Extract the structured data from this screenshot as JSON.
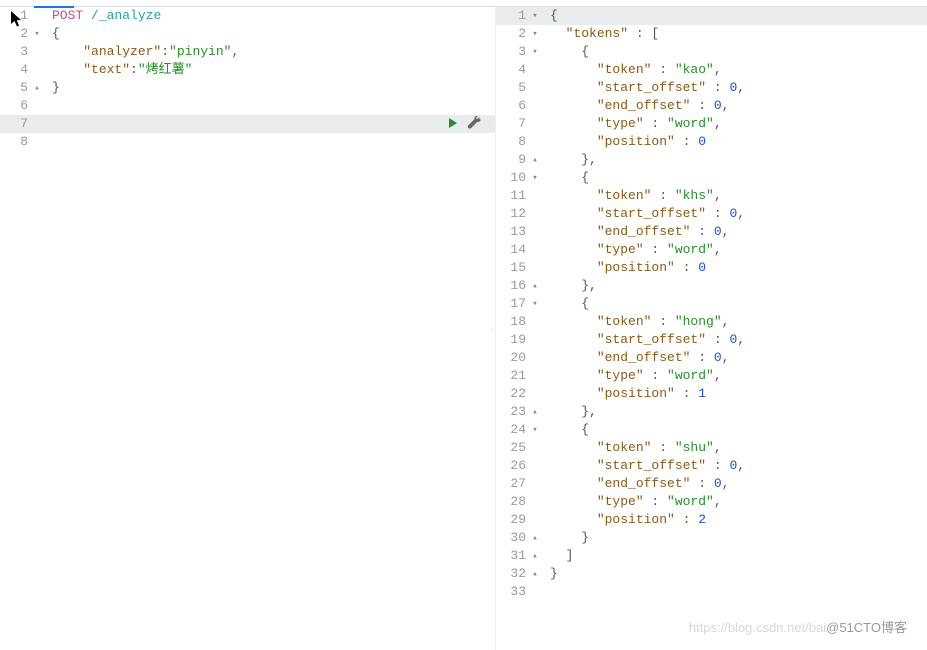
{
  "watermark_left": "https://blog.csdn.net/bai",
  "watermark_right": "@51CTO博客",
  "left_editor": {
    "highlight_index": 6,
    "lines": [
      {
        "num": "1",
        "fold": "",
        "tokens": [
          [
            "keyword",
            "POST"
          ],
          [
            "punct",
            " "
          ],
          [
            "endpoint",
            "/_analyze"
          ]
        ]
      },
      {
        "num": "2",
        "fold": "▾",
        "tokens": [
          [
            "brace",
            "{"
          ]
        ]
      },
      {
        "num": "3",
        "fold": "",
        "tokens": [
          [
            "punct",
            "    "
          ],
          [
            "key",
            "\"analyzer\""
          ],
          [
            "punct",
            ":"
          ],
          [
            "string",
            "\"pinyin\""
          ],
          [
            "punct",
            ","
          ]
        ]
      },
      {
        "num": "4",
        "fold": "",
        "tokens": [
          [
            "punct",
            "    "
          ],
          [
            "key",
            "\"text\""
          ],
          [
            "punct",
            ":"
          ],
          [
            "string",
            "\"烤红薯\""
          ]
        ]
      },
      {
        "num": "5",
        "fold": "▴",
        "tokens": [
          [
            "brace",
            "}"
          ]
        ]
      },
      {
        "num": "6",
        "fold": "",
        "tokens": []
      },
      {
        "num": "7",
        "fold": "",
        "tokens": []
      },
      {
        "num": "8",
        "fold": "",
        "tokens": []
      }
    ]
  },
  "right_editor": {
    "highlight_index": 0,
    "lines": [
      {
        "num": "1",
        "fold": "▾",
        "tokens": [
          [
            "brace",
            "{"
          ]
        ]
      },
      {
        "num": "2",
        "fold": "▾",
        "tokens": [
          [
            "punct",
            "  "
          ],
          [
            "key",
            "\"tokens\""
          ],
          [
            "punct",
            " : ["
          ]
        ]
      },
      {
        "num": "3",
        "fold": "▾",
        "tokens": [
          [
            "punct",
            "    "
          ],
          [
            "brace",
            "{"
          ]
        ]
      },
      {
        "num": "4",
        "fold": "",
        "tokens": [
          [
            "punct",
            "      "
          ],
          [
            "key",
            "\"token\""
          ],
          [
            "punct",
            " : "
          ],
          [
            "string",
            "\"kao\""
          ],
          [
            "punct",
            ","
          ]
        ]
      },
      {
        "num": "5",
        "fold": "",
        "tokens": [
          [
            "punct",
            "      "
          ],
          [
            "key",
            "\"start_offset\""
          ],
          [
            "punct",
            " : "
          ],
          [
            "number",
            "0"
          ],
          [
            "punct",
            ","
          ]
        ]
      },
      {
        "num": "6",
        "fold": "",
        "tokens": [
          [
            "punct",
            "      "
          ],
          [
            "key",
            "\"end_offset\""
          ],
          [
            "punct",
            " : "
          ],
          [
            "number",
            "0"
          ],
          [
            "punct",
            ","
          ]
        ]
      },
      {
        "num": "7",
        "fold": "",
        "tokens": [
          [
            "punct",
            "      "
          ],
          [
            "key",
            "\"type\""
          ],
          [
            "punct",
            " : "
          ],
          [
            "string",
            "\"word\""
          ],
          [
            "punct",
            ","
          ]
        ]
      },
      {
        "num": "8",
        "fold": "",
        "tokens": [
          [
            "punct",
            "      "
          ],
          [
            "key",
            "\"position\""
          ],
          [
            "punct",
            " : "
          ],
          [
            "number",
            "0"
          ]
        ]
      },
      {
        "num": "9",
        "fold": "▴",
        "tokens": [
          [
            "punct",
            "    "
          ],
          [
            "brace",
            "}"
          ],
          [
            "punct",
            ","
          ]
        ]
      },
      {
        "num": "10",
        "fold": "▾",
        "tokens": [
          [
            "punct",
            "    "
          ],
          [
            "brace",
            "{"
          ]
        ]
      },
      {
        "num": "11",
        "fold": "",
        "tokens": [
          [
            "punct",
            "      "
          ],
          [
            "key",
            "\"token\""
          ],
          [
            "punct",
            " : "
          ],
          [
            "string",
            "\"khs\""
          ],
          [
            "punct",
            ","
          ]
        ]
      },
      {
        "num": "12",
        "fold": "",
        "tokens": [
          [
            "punct",
            "      "
          ],
          [
            "key",
            "\"start_offset\""
          ],
          [
            "punct",
            " : "
          ],
          [
            "number",
            "0"
          ],
          [
            "punct",
            ","
          ]
        ]
      },
      {
        "num": "13",
        "fold": "",
        "tokens": [
          [
            "punct",
            "      "
          ],
          [
            "key",
            "\"end_offset\""
          ],
          [
            "punct",
            " : "
          ],
          [
            "number",
            "0"
          ],
          [
            "punct",
            ","
          ]
        ]
      },
      {
        "num": "14",
        "fold": "",
        "tokens": [
          [
            "punct",
            "      "
          ],
          [
            "key",
            "\"type\""
          ],
          [
            "punct",
            " : "
          ],
          [
            "string",
            "\"word\""
          ],
          [
            "punct",
            ","
          ]
        ]
      },
      {
        "num": "15",
        "fold": "",
        "tokens": [
          [
            "punct",
            "      "
          ],
          [
            "key",
            "\"position\""
          ],
          [
            "punct",
            " : "
          ],
          [
            "number",
            "0"
          ]
        ]
      },
      {
        "num": "16",
        "fold": "▴",
        "tokens": [
          [
            "punct",
            "    "
          ],
          [
            "brace",
            "}"
          ],
          [
            "punct",
            ","
          ]
        ]
      },
      {
        "num": "17",
        "fold": "▾",
        "tokens": [
          [
            "punct",
            "    "
          ],
          [
            "brace",
            "{"
          ]
        ]
      },
      {
        "num": "18",
        "fold": "",
        "tokens": [
          [
            "punct",
            "      "
          ],
          [
            "key",
            "\"token\""
          ],
          [
            "punct",
            " : "
          ],
          [
            "string",
            "\"hong\""
          ],
          [
            "punct",
            ","
          ]
        ]
      },
      {
        "num": "19",
        "fold": "",
        "tokens": [
          [
            "punct",
            "      "
          ],
          [
            "key",
            "\"start_offset\""
          ],
          [
            "punct",
            " : "
          ],
          [
            "number",
            "0"
          ],
          [
            "punct",
            ","
          ]
        ]
      },
      {
        "num": "20",
        "fold": "",
        "tokens": [
          [
            "punct",
            "      "
          ],
          [
            "key",
            "\"end_offset\""
          ],
          [
            "punct",
            " : "
          ],
          [
            "number",
            "0"
          ],
          [
            "punct",
            ","
          ]
        ]
      },
      {
        "num": "21",
        "fold": "",
        "tokens": [
          [
            "punct",
            "      "
          ],
          [
            "key",
            "\"type\""
          ],
          [
            "punct",
            " : "
          ],
          [
            "string",
            "\"word\""
          ],
          [
            "punct",
            ","
          ]
        ]
      },
      {
        "num": "22",
        "fold": "",
        "tokens": [
          [
            "punct",
            "      "
          ],
          [
            "key",
            "\"position\""
          ],
          [
            "punct",
            " : "
          ],
          [
            "number",
            "1"
          ]
        ]
      },
      {
        "num": "23",
        "fold": "▴",
        "tokens": [
          [
            "punct",
            "    "
          ],
          [
            "brace",
            "}"
          ],
          [
            "punct",
            ","
          ]
        ]
      },
      {
        "num": "24",
        "fold": "▾",
        "tokens": [
          [
            "punct",
            "    "
          ],
          [
            "brace",
            "{"
          ]
        ]
      },
      {
        "num": "25",
        "fold": "",
        "tokens": [
          [
            "punct",
            "      "
          ],
          [
            "key",
            "\"token\""
          ],
          [
            "punct",
            " : "
          ],
          [
            "string",
            "\"shu\""
          ],
          [
            "punct",
            ","
          ]
        ]
      },
      {
        "num": "26",
        "fold": "",
        "tokens": [
          [
            "punct",
            "      "
          ],
          [
            "key",
            "\"start_offset\""
          ],
          [
            "punct",
            " : "
          ],
          [
            "number",
            "0"
          ],
          [
            "punct",
            ","
          ]
        ]
      },
      {
        "num": "27",
        "fold": "",
        "tokens": [
          [
            "punct",
            "      "
          ],
          [
            "key",
            "\"end_offset\""
          ],
          [
            "punct",
            " : "
          ],
          [
            "number",
            "0"
          ],
          [
            "punct",
            ","
          ]
        ]
      },
      {
        "num": "28",
        "fold": "",
        "tokens": [
          [
            "punct",
            "      "
          ],
          [
            "key",
            "\"type\""
          ],
          [
            "punct",
            " : "
          ],
          [
            "string",
            "\"word\""
          ],
          [
            "punct",
            ","
          ]
        ]
      },
      {
        "num": "29",
        "fold": "",
        "tokens": [
          [
            "punct",
            "      "
          ],
          [
            "key",
            "\"position\""
          ],
          [
            "punct",
            " : "
          ],
          [
            "number",
            "2"
          ]
        ]
      },
      {
        "num": "30",
        "fold": "▴",
        "tokens": [
          [
            "punct",
            "    "
          ],
          [
            "brace",
            "}"
          ]
        ]
      },
      {
        "num": "31",
        "fold": "▴",
        "tokens": [
          [
            "punct",
            "  ]"
          ]
        ]
      },
      {
        "num": "32",
        "fold": "▴",
        "tokens": [
          [
            "brace",
            "}"
          ]
        ]
      },
      {
        "num": "33",
        "fold": "",
        "tokens": []
      }
    ]
  }
}
